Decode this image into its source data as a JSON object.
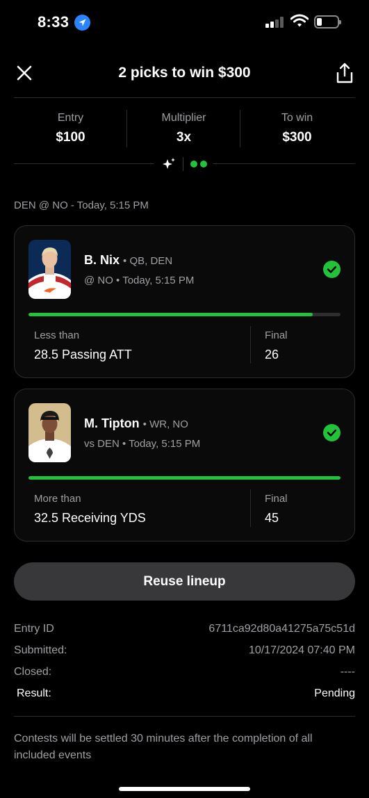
{
  "status_bar": {
    "time": "8:33"
  },
  "header": {
    "title": "2 picks to win $300"
  },
  "stats": [
    {
      "label": "Entry",
      "value": "$100"
    },
    {
      "label": "Multiplier",
      "value": "3x"
    },
    {
      "label": "To win",
      "value": "$300"
    }
  ],
  "game_line": "DEN @ NO - Today, 5:15 PM",
  "picks": [
    {
      "name": "B. Nix",
      "meta": "• QB, DEN",
      "match": "@ NO • Today, 5:15 PM",
      "direction": "Less than",
      "line": "28.5 Passing ATT",
      "final_label": "Final",
      "final_value": "26",
      "progress": 0.91,
      "status": "check-circle-icon"
    },
    {
      "name": "M. Tipton",
      "meta": "• WR, NO",
      "match": "vs DEN • Today, 5:15 PM",
      "direction": "More than",
      "line": "32.5 Receiving YDS",
      "final_label": "Final",
      "final_value": "45",
      "progress": 1.0,
      "status": "check-circle-icon"
    }
  ],
  "reuse_button": "Reuse lineup",
  "details": [
    {
      "key": "Entry ID",
      "value": "6711ca92d80a41275a75c51d"
    },
    {
      "key": "Submitted:",
      "value": "10/17/2024 07:40 PM"
    },
    {
      "key": "Closed:",
      "value": "----"
    },
    {
      "key": "Result:",
      "value": "Pending"
    }
  ],
  "note": "Contests will be settled 30 minutes after the completion of all included events",
  "colors": {
    "accent_green": "#22c33a",
    "background": "#000000",
    "card_border": "#2c2c2e",
    "button": "#38383b"
  }
}
